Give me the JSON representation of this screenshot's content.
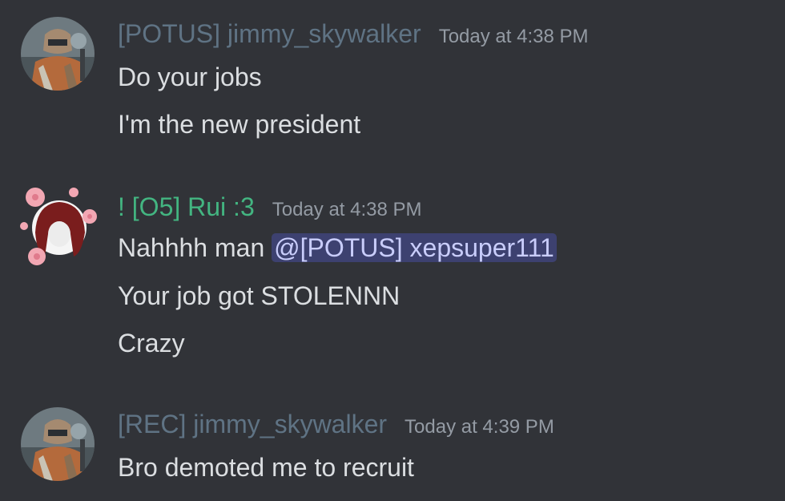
{
  "colors": {
    "background": "#313338",
    "rec_role": "#5f7384",
    "o5_role": "#43b581",
    "timestamp": "#949ba4",
    "message_text": "#dbdee1",
    "mention_bg": "#3c4270",
    "mention_text": "#c9cdfb"
  },
  "messages": [
    {
      "username": "[POTUS] jimmy_skywalker",
      "timestamp": "Today at 4:38 PM",
      "avatar_icon": "armored-soldier-avatar",
      "lines": [
        "Do your jobs",
        "I'm the new president"
      ]
    },
    {
      "username": "! [O5] Rui :3",
      "timestamp": "Today at 4:38 PM",
      "avatar_icon": "anime-girl-sakura-avatar",
      "line1_prefix": "Nahhhh man ",
      "mention": "@[POTUS] xepsuper111",
      "lines": [
        "Your job got STOLENNN",
        "Crazy"
      ]
    },
    {
      "username": "[REC] jimmy_skywalker",
      "timestamp": "Today at 4:39 PM",
      "avatar_icon": "armored-soldier-avatar",
      "lines": [
        "Bro demoted me to recruit"
      ]
    }
  ]
}
